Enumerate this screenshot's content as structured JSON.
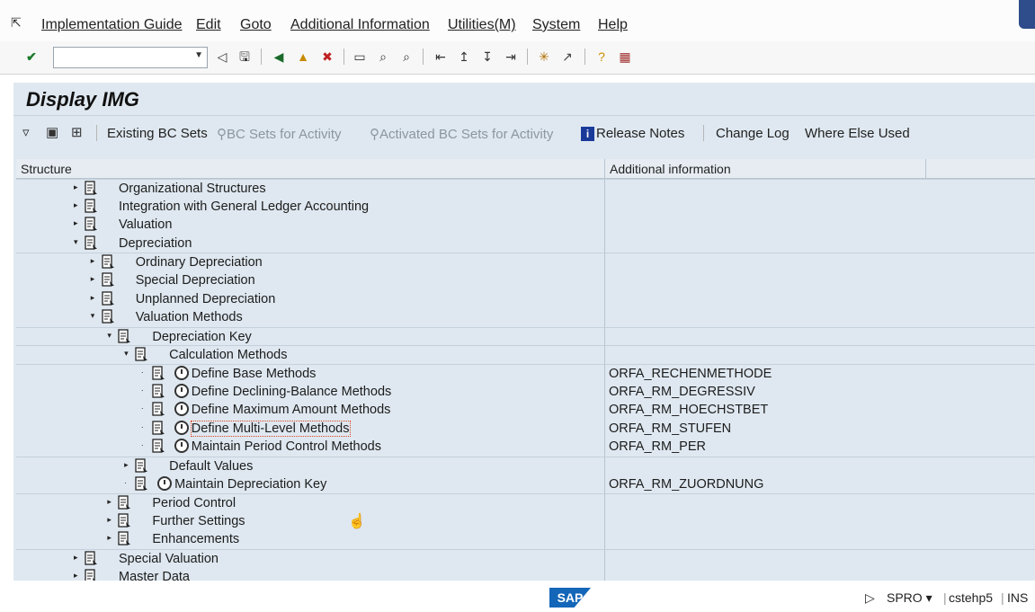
{
  "menubar": {
    "items": [
      "Implementation Guide",
      "Edit",
      "Goto",
      "Additional Information",
      "Utilities(M)",
      "System",
      "Help"
    ]
  },
  "toolbar": {
    "command_field_value": ""
  },
  "page": {
    "title": "Display IMG"
  },
  "app_toolbar": {
    "existing_bc_sets": "Existing BC Sets",
    "bc_sets_for_activity": "BC Sets for Activity",
    "activated_bc_sets_for_activity": "Activated BC Sets for Activity",
    "release_notes": "Release Notes",
    "change_log": "Change Log",
    "where_else_used": "Where Else Used"
  },
  "tree": {
    "columns": [
      "Structure",
      "Additional information"
    ],
    "rows": [
      {
        "label": "Organizational Structures",
        "info": "",
        "level": 0,
        "expand": "collapsed",
        "clock": false
      },
      {
        "label": "Integration with General Ledger Accounting",
        "info": "",
        "level": 0,
        "expand": "collapsed",
        "clock": false
      },
      {
        "label": "Valuation",
        "info": "",
        "level": 0,
        "expand": "collapsed",
        "clock": false
      },
      {
        "label": "Depreciation",
        "info": "",
        "level": 0,
        "expand": "expanded",
        "clock": false
      },
      {
        "label": "Ordinary Depreciation",
        "info": "",
        "level": 1,
        "expand": "collapsed",
        "clock": false
      },
      {
        "label": "Special Depreciation",
        "info": "",
        "level": 1,
        "expand": "collapsed",
        "clock": false
      },
      {
        "label": "Unplanned Depreciation",
        "info": "",
        "level": 1,
        "expand": "collapsed",
        "clock": false
      },
      {
        "label": "Valuation Methods",
        "info": "",
        "level": 1,
        "expand": "expanded",
        "clock": false
      },
      {
        "label": "Depreciation Key",
        "info": "",
        "level": 2,
        "expand": "expanded",
        "clock": false
      },
      {
        "label": "Calculation Methods",
        "info": "",
        "level": 3,
        "expand": "expanded",
        "clock": false
      },
      {
        "label": "Define Base Methods",
        "info": "ORFA_RECHENMETHODE",
        "level": 4,
        "expand": "leaf",
        "clock": true
      },
      {
        "label": "Define Declining-Balance Methods",
        "info": "ORFA_RM_DEGRESSIV",
        "level": 4,
        "expand": "leaf",
        "clock": true
      },
      {
        "label": "Define Maximum Amount Methods",
        "info": "ORFA_RM_HOECHSTBET",
        "level": 4,
        "expand": "leaf",
        "clock": true
      },
      {
        "label": "Define Multi-Level Methods",
        "info": "ORFA_RM_STUFEN",
        "level": 4,
        "expand": "leaf",
        "clock": true,
        "focused": true
      },
      {
        "label": "Maintain Period Control Methods",
        "info": "ORFA_RM_PER",
        "level": 4,
        "expand": "leaf",
        "clock": true
      },
      {
        "label": "Default Values",
        "info": "",
        "level": 3,
        "expand": "collapsed",
        "clock": false
      },
      {
        "label": "Maintain Depreciation Key",
        "info": "ORFA_RM_ZUORDNUNG",
        "level": 3,
        "expand": "leaf",
        "clock": true
      },
      {
        "label": "Period Control",
        "info": "",
        "level": 2,
        "expand": "collapsed",
        "clock": false
      },
      {
        "label": "Further Settings",
        "info": "",
        "level": 2,
        "expand": "collapsed",
        "clock": false
      },
      {
        "label": "Enhancements",
        "info": "",
        "level": 2,
        "expand": "collapsed",
        "clock": false
      },
      {
        "label": "Special Valuation",
        "info": "",
        "level": 0,
        "expand": "collapsed",
        "clock": false
      },
      {
        "label": "Master Data",
        "info": "",
        "level": 0,
        "expand": "collapsed",
        "clock": false
      }
    ]
  },
  "status": {
    "logo": "SAP",
    "transaction": "SPRO",
    "server": "cstehp5",
    "mode": "INS"
  }
}
